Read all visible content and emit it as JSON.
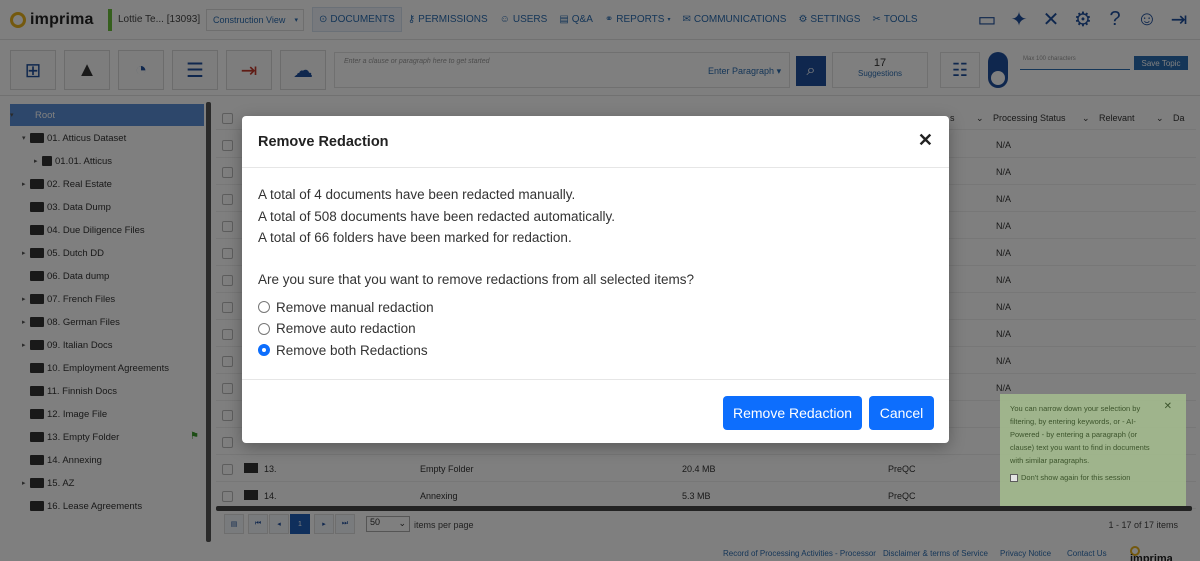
{
  "brand": {
    "name": "imprima"
  },
  "project": {
    "name": "Lottie Te...",
    "id": "[13093]",
    "view": "Construction View"
  },
  "nav": {
    "items": [
      {
        "icon": "documents-icon",
        "label": "DOCUMENTS",
        "active": true
      },
      {
        "icon": "permissions-icon",
        "label": "PERMISSIONS"
      },
      {
        "icon": "users-icon",
        "label": "USERS"
      },
      {
        "icon": "qa-icon",
        "label": "Q&A"
      },
      {
        "icon": "reports-icon",
        "label": "REPORTS"
      },
      {
        "icon": "communications-icon",
        "label": "COMMUNICATIONS"
      },
      {
        "icon": "settings-icon",
        "label": "SETTINGS"
      },
      {
        "icon": "tools-icon",
        "label": "TOOLS"
      }
    ]
  },
  "toolbar": {
    "clause_placeholder": "Enter a clause or paragraph here to get started",
    "enter_paragraph": "Enter Paragraph",
    "suggestions_count": "17",
    "suggestions_label": "Suggestions",
    "topic_placeholder": "Max 100 characters",
    "save_topic": "Save Topic"
  },
  "tree": {
    "items": [
      {
        "label": "Root",
        "selected": true
      },
      {
        "label": "01. Atticus Dataset"
      },
      {
        "label": "01.01. Atticus"
      },
      {
        "label": "02. Real Estate"
      },
      {
        "label": "03. Data Dump"
      },
      {
        "label": "04. Due Diligence Files"
      },
      {
        "label": "05. Dutch DD"
      },
      {
        "label": "06. Data dump"
      },
      {
        "label": "07. French Files"
      },
      {
        "label": "08. German Files"
      },
      {
        "label": "09. Italian Docs"
      },
      {
        "label": "10. Employment Agreements"
      },
      {
        "label": "11. Finnish Docs"
      },
      {
        "label": "12. Image File"
      },
      {
        "label": "13. Empty Folder"
      },
      {
        "label": "14. Annexing"
      },
      {
        "label": "15. AZ"
      },
      {
        "label": "16. Lease Agreements"
      }
    ]
  },
  "grid": {
    "headers": {
      "processing_status": "Processing Status",
      "relevant": "Relevant",
      "da": "Da",
      "status_partial": "s"
    },
    "status_values": [
      "N/A",
      "N/A",
      "N/A",
      "N/A",
      "N/A",
      "N/A",
      "N/A",
      "N/A",
      "N/A",
      "N/A"
    ],
    "rows": [
      {
        "index": "13.",
        "name": "Empty Folder",
        "size": "20.4 MB",
        "stage": "PreQC"
      },
      {
        "index": "14.",
        "name": "Annexing",
        "size": "5.3 MB",
        "stage": "PreQC"
      }
    ]
  },
  "pager": {
    "current_page": "1",
    "per_page": "50",
    "per_page_label": "items per page",
    "items_info": "1 - 17 of 17 items"
  },
  "tip": {
    "text": "You can narrow down your selection by filtering, by entering keywords, or - AI-Powered - by entering a paragraph (or clause) text you want to find in documents with similar paragraphs.",
    "checkbox_label": "Don't show again for this session"
  },
  "footer": {
    "links": [
      "Record of Processing Activities - Processor",
      "Disclaimer & terms of Service",
      "Privacy Notice",
      "Contact Us"
    ],
    "brand": "imprima"
  },
  "modal": {
    "title": "Remove Redaction",
    "lines": [
      "A total of 4 documents have been redacted manually.",
      "A total of 508 documents have been redacted automatically.",
      "A total of 66 folders have been marked for redaction."
    ],
    "question": "Are you sure that you want to remove redactions from all selected items?",
    "options": [
      {
        "label": "Remove manual redaction",
        "selected": false
      },
      {
        "label": "Remove auto redaction",
        "selected": false
      },
      {
        "label": "Remove both Redactions",
        "selected": true
      }
    ],
    "confirm_label": "Remove Redaction",
    "cancel_label": "Cancel"
  }
}
